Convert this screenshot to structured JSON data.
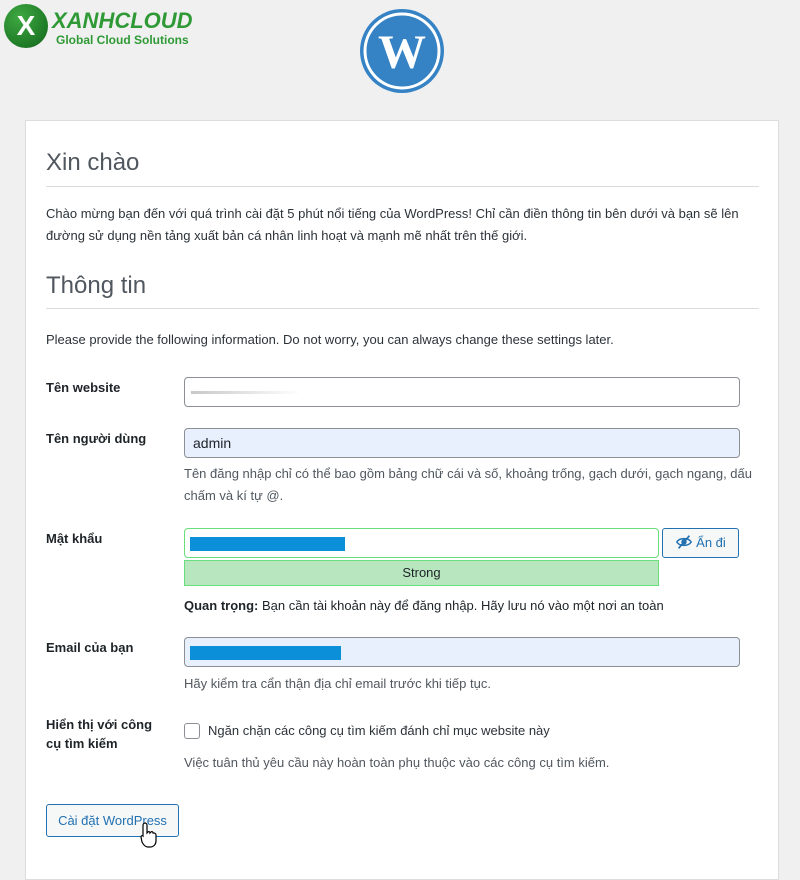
{
  "brand": {
    "icon_letter": "X",
    "name": "XANHCLOUD",
    "tagline": "Global Cloud Solutions"
  },
  "wordpress_logo": "wordpress-icon",
  "welcome": {
    "heading": "Xin chào",
    "text": "Chào mừng bạn đến với quá trình cài đặt 5 phút nổi tiếng của WordPress! Chỉ cần điền thông tin bên dưới và bạn sẽ lên đường sử dụng nền tảng xuất bản cá nhân linh hoạt và mạnh mẽ nhất trên thế giới."
  },
  "info": {
    "heading": "Thông tin",
    "text": "Please provide the following information. Do not worry, you can always change these settings later."
  },
  "form": {
    "site_title": {
      "label": "Tên website",
      "value": ""
    },
    "username": {
      "label": "Tên người dùng",
      "value": "admin",
      "help": "Tên đăng nhập chỉ có thể bao gồm bảng chữ cái và số, khoảng trống, gạch dưới, gạch ngang, dấu chấm và kí tự @."
    },
    "password": {
      "label": "Mật khẩu",
      "hide_button": "Ẩn đi",
      "strength": "Strong",
      "important_label": "Quan trọng:",
      "important_text": " Bạn cần tài khoản này để đăng nhập. Hãy lưu nó vào một nơi an toàn"
    },
    "email": {
      "label": "Email của bạn",
      "help": "Hãy kiểm tra cẩn thận địa chỉ email trước khi tiếp tục."
    },
    "visibility": {
      "label_line1": "Hiển thị với công",
      "label_line2": "cụ tìm kiếm",
      "checkbox_label": "Ngăn chặn các công cụ tìm kiếm đánh chỉ mục website này",
      "checked": false,
      "help": "Việc tuân thủ yêu cầu này hoàn toàn phụ thuộc vào các công cụ tìm kiếm."
    },
    "submit": "Cài đặt WordPress"
  },
  "colors": {
    "accent": "#2271b1",
    "brand_green": "#2f9a35",
    "strength_bg": "#b8e6bf",
    "redaction": "#0a8fd8"
  }
}
